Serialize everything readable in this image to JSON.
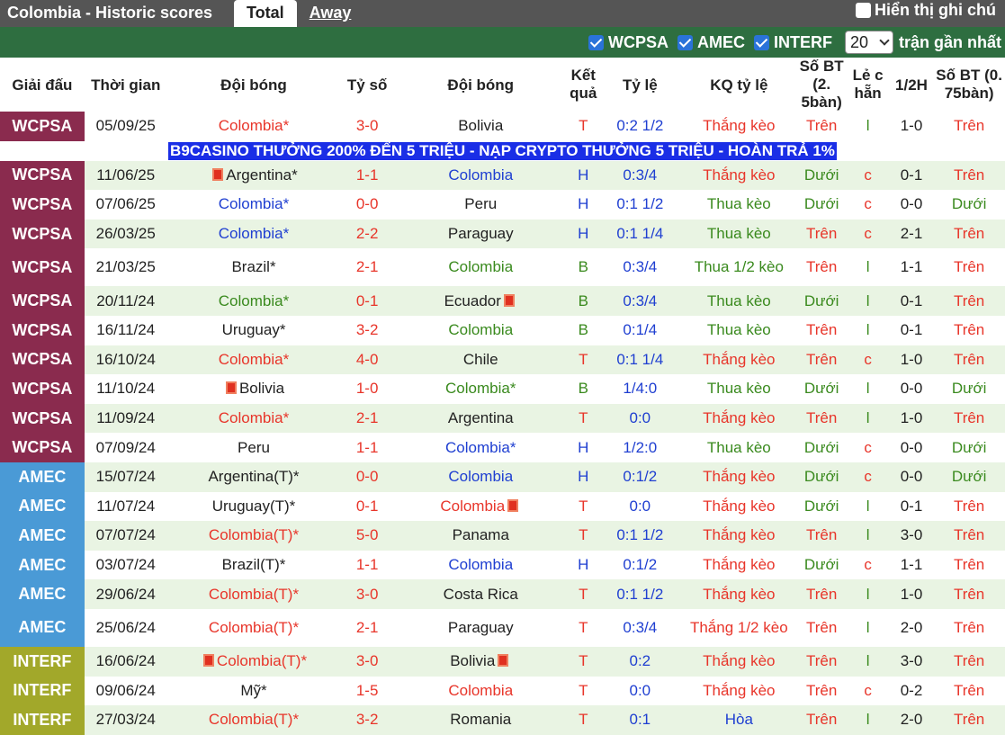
{
  "header": {
    "title": "Colombia - Historic scores",
    "tab_total": "Total",
    "tab_away": "Away",
    "show_label": "Hiển thị ghi chú"
  },
  "filters": {
    "wcpsa": "WCPSA",
    "amec": "AMEC",
    "interf": "INTERF",
    "count": "20",
    "suffix": "trận gần nhất"
  },
  "columns": {
    "league": "Giải đấu",
    "time": "Thời gian",
    "team1": "Đội bóng",
    "score": "Tỷ số",
    "team2": "Đội bóng",
    "result": "Kết quả",
    "odds": "Tỷ lệ",
    "odds_result": "KQ tỷ lệ",
    "bt1": "Số BT (2. 5bàn)",
    "oddeven": "Lẻ c hẵn",
    "half": "1/2H",
    "bt2": "Số BT (0. 75bàn)"
  },
  "banner": "B9CASINO THƯỞNG 200% ĐẾN 5 TRIỆU - NẠP CRYPTO THƯỞNG 5 TRIỆU - HOÀN TRẢ 1%",
  "colors": {
    "wcpsa": "#8a2b4e",
    "amec": "#4a9ad6",
    "interf": "#a2a82a",
    "red": "#e8352a",
    "blue": "#1f3fd1",
    "green": "#3a8a1e"
  },
  "rows": [
    {
      "league": "WCPSA",
      "date": "05/09/25",
      "team1": "Colombia*",
      "team1_color": "red",
      "team1_flag": false,
      "score": "3-0",
      "team2": "Bolivia",
      "team2_color": "dark",
      "team2_flag": false,
      "result": "T",
      "odds": "0:2 1/2",
      "odds_result": "Thắng kèo",
      "bt1": "Trên",
      "oe": "l",
      "half": "1-0",
      "bt2": "Trên"
    },
    {
      "league": "WCPSA",
      "date": "11/06/25",
      "team1": "Argentina*",
      "team1_color": "dark",
      "team1_flag": true,
      "score": "1-1",
      "team2": "Colombia",
      "team2_color": "blue",
      "team2_flag": false,
      "result": "H",
      "odds": "0:3/4",
      "odds_result": "Thắng kèo",
      "bt1": "Dưới",
      "oe": "c",
      "half": "0-1",
      "bt2": "Trên"
    },
    {
      "league": "WCPSA",
      "date": "07/06/25",
      "team1": "Colombia*",
      "team1_color": "blue",
      "team1_flag": false,
      "score": "0-0",
      "team2": "Peru",
      "team2_color": "dark",
      "team2_flag": false,
      "result": "H",
      "odds": "0:1 1/2",
      "odds_result": "Thua kèo",
      "bt1": "Dưới",
      "oe": "c",
      "half": "0-0",
      "bt2": "Dưới"
    },
    {
      "league": "WCPSA",
      "date": "26/03/25",
      "team1": "Colombia*",
      "team1_color": "blue",
      "team1_flag": false,
      "score": "2-2",
      "team2": "Paraguay",
      "team2_color": "dark",
      "team2_flag": false,
      "result": "H",
      "odds": "0:1 1/4",
      "odds_result": "Thua kèo",
      "bt1": "Trên",
      "oe": "c",
      "half": "2-1",
      "bt2": "Trên"
    },
    {
      "league": "WCPSA",
      "date": "21/03/25",
      "team1": "Brazil*",
      "team1_color": "dark",
      "team1_flag": false,
      "score": "2-1",
      "team2": "Colombia",
      "team2_color": "green",
      "team2_flag": false,
      "result": "B",
      "odds": "0:3/4",
      "odds_result": "Thua 1/2 kèo",
      "bt1": "Trên",
      "oe": "l",
      "half": "1-1",
      "bt2": "Trên",
      "tall": true
    },
    {
      "league": "WCPSA",
      "date": "20/11/24",
      "team1": "Colombia*",
      "team1_color": "green",
      "team1_flag": false,
      "score": "0-1",
      "team2": "Ecuador",
      "team2_color": "dark",
      "team2_flag": true,
      "result": "B",
      "odds": "0:3/4",
      "odds_result": "Thua kèo",
      "bt1": "Dưới",
      "oe": "l",
      "half": "0-1",
      "bt2": "Trên"
    },
    {
      "league": "WCPSA",
      "date": "16/11/24",
      "team1": "Uruguay*",
      "team1_color": "dark",
      "team1_flag": false,
      "score": "3-2",
      "team2": "Colombia",
      "team2_color": "green",
      "team2_flag": false,
      "result": "B",
      "odds": "0:1/4",
      "odds_result": "Thua kèo",
      "bt1": "Trên",
      "oe": "l",
      "half": "0-1",
      "bt2": "Trên"
    },
    {
      "league": "WCPSA",
      "date": "16/10/24",
      "team1": "Colombia*",
      "team1_color": "red",
      "team1_flag": false,
      "score": "4-0",
      "team2": "Chile",
      "team2_color": "dark",
      "team2_flag": false,
      "result": "T",
      "odds": "0:1 1/4",
      "odds_result": "Thắng kèo",
      "bt1": "Trên",
      "oe": "c",
      "half": "1-0",
      "bt2": "Trên"
    },
    {
      "league": "WCPSA",
      "date": "11/10/24",
      "team1": "Bolivia",
      "team1_color": "dark",
      "team1_flag": true,
      "score": "1-0",
      "team2": "Colombia*",
      "team2_color": "green",
      "team2_flag": false,
      "result": "B",
      "odds": "1/4:0",
      "odds_result": "Thua kèo",
      "bt1": "Dưới",
      "oe": "l",
      "half": "0-0",
      "bt2": "Dưới"
    },
    {
      "league": "WCPSA",
      "date": "11/09/24",
      "team1": "Colombia*",
      "team1_color": "red",
      "team1_flag": false,
      "score": "2-1",
      "team2": "Argentina",
      "team2_color": "dark",
      "team2_flag": false,
      "result": "T",
      "odds": "0:0",
      "odds_result": "Thắng kèo",
      "bt1": "Trên",
      "oe": "l",
      "half": "1-0",
      "bt2": "Trên"
    },
    {
      "league": "WCPSA",
      "date": "07/09/24",
      "team1": "Peru",
      "team1_color": "dark",
      "team1_flag": false,
      "score": "1-1",
      "team2": "Colombia*",
      "team2_color": "blue",
      "team2_flag": false,
      "result": "H",
      "odds": "1/2:0",
      "odds_result": "Thua kèo",
      "bt1": "Dưới",
      "oe": "c",
      "half": "0-0",
      "bt2": "Dưới"
    },
    {
      "league": "AMEC",
      "date": "15/07/24",
      "team1": "Argentina(T)*",
      "team1_color": "dark",
      "team1_flag": false,
      "score": "0-0",
      "team2": "Colombia",
      "team2_color": "blue",
      "team2_flag": false,
      "result": "H",
      "odds": "0:1/2",
      "odds_result": "Thắng kèo",
      "bt1": "Dưới",
      "oe": "c",
      "half": "0-0",
      "bt2": "Dưới"
    },
    {
      "league": "AMEC",
      "date": "11/07/24",
      "team1": "Uruguay(T)*",
      "team1_color": "dark",
      "team1_flag": false,
      "score": "0-1",
      "team2": "Colombia",
      "team2_color": "red",
      "team2_flag": true,
      "result": "T",
      "odds": "0:0",
      "odds_result": "Thắng kèo",
      "bt1": "Dưới",
      "oe": "l",
      "half": "0-1",
      "bt2": "Trên"
    },
    {
      "league": "AMEC",
      "date": "07/07/24",
      "team1": "Colombia(T)*",
      "team1_color": "red",
      "team1_flag": false,
      "score": "5-0",
      "team2": "Panama",
      "team2_color": "dark",
      "team2_flag": false,
      "result": "T",
      "odds": "0:1 1/2",
      "odds_result": "Thắng kèo",
      "bt1": "Trên",
      "oe": "l",
      "half": "3-0",
      "bt2": "Trên"
    },
    {
      "league": "AMEC",
      "date": "03/07/24",
      "team1": "Brazil(T)*",
      "team1_color": "dark",
      "team1_flag": false,
      "score": "1-1",
      "team2": "Colombia",
      "team2_color": "blue",
      "team2_flag": false,
      "result": "H",
      "odds": "0:1/2",
      "odds_result": "Thắng kèo",
      "bt1": "Dưới",
      "oe": "c",
      "half": "1-1",
      "bt2": "Trên"
    },
    {
      "league": "AMEC",
      "date": "29/06/24",
      "team1": "Colombia(T)*",
      "team1_color": "red",
      "team1_flag": false,
      "score": "3-0",
      "team2": "Costa Rica",
      "team2_color": "dark",
      "team2_flag": false,
      "result": "T",
      "odds": "0:1 1/2",
      "odds_result": "Thắng kèo",
      "bt1": "Trên",
      "oe": "l",
      "half": "1-0",
      "bt2": "Trên"
    },
    {
      "league": "AMEC",
      "date": "25/06/24",
      "team1": "Colombia(T)*",
      "team1_color": "red",
      "team1_flag": false,
      "score": "2-1",
      "team2": "Paraguay",
      "team2_color": "dark",
      "team2_flag": false,
      "result": "T",
      "odds": "0:3/4",
      "odds_result": "Thắng 1/2 kèo",
      "bt1": "Trên",
      "oe": "l",
      "half": "2-0",
      "bt2": "Trên",
      "tall": true
    },
    {
      "league": "INTERF",
      "date": "16/06/24",
      "team1": "Colombia(T)*",
      "team1_color": "red",
      "team1_flag": true,
      "score": "3-0",
      "team2": "Bolivia",
      "team2_color": "dark",
      "team2_flag": true,
      "result": "T",
      "odds": "0:2",
      "odds_result": "Thắng kèo",
      "bt1": "Trên",
      "oe": "l",
      "half": "3-0",
      "bt2": "Trên"
    },
    {
      "league": "INTERF",
      "date": "09/06/24",
      "team1": "Mỹ*",
      "team1_color": "dark",
      "team1_flag": false,
      "score": "1-5",
      "team2": "Colombia",
      "team2_color": "red",
      "team2_flag": false,
      "result": "T",
      "odds": "0:0",
      "odds_result": "Thắng kèo",
      "bt1": "Trên",
      "oe": "c",
      "half": "0-2",
      "bt2": "Trên"
    },
    {
      "league": "INTERF",
      "date": "27/03/24",
      "team1": "Colombia(T)*",
      "team1_color": "red",
      "team1_flag": false,
      "score": "3-2",
      "team2": "Romania",
      "team2_color": "dark",
      "team2_flag": false,
      "result": "T",
      "odds": "0:1",
      "odds_result": "Hòa",
      "bt1": "Trên",
      "oe": "l",
      "half": "2-0",
      "bt2": "Trên"
    }
  ]
}
